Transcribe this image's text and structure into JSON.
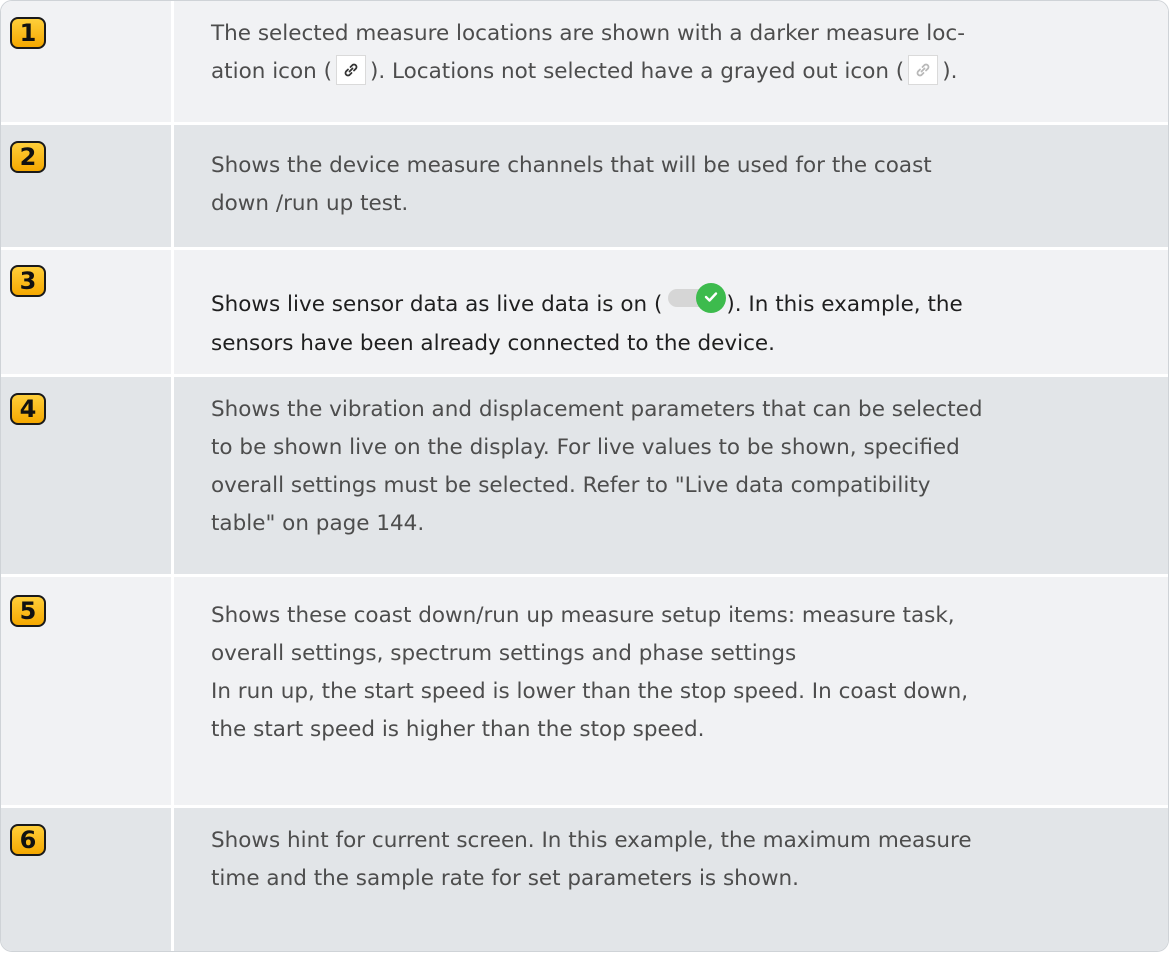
{
  "rows": [
    {
      "number": "1",
      "lines": [
        "The selected measure locations are shown with a darker measure loc-",
        "ation icon (",
        "). Locations not selected have a grayed out icon (",
        ")."
      ]
    },
    {
      "number": "2",
      "lines": [
        "Shows the device measure channels that will be used for the coast",
        "down /run up test."
      ]
    },
    {
      "number": "3",
      "lines": [
        "Shows live sensor data as live data is on (",
        "). In this example, the",
        "sensors have been already connected to the device."
      ]
    },
    {
      "number": "4",
      "lines": [
        "Shows the vibration and displacement parameters that can be selected",
        "to be shown live on the display. For live values to be shown, specified",
        "overall settings must be selected. Refer to \"Live data compatibility",
        "table\" on page 144."
      ]
    },
    {
      "number": "5",
      "lines": [
        "Shows these coast down/run up measure setup items: measure task,",
        "overall settings, spectrum settings and phase settings",
        "In run up, the start speed is lower than the stop speed. In coast down,",
        "the start speed is higher than the stop speed."
      ]
    },
    {
      "number": "6",
      "lines": [
        "Shows hint for current screen. In this example, the maximum measure",
        "time and the sample rate for set parameters is shown."
      ]
    }
  ],
  "icons": {
    "location_selected": "link-icon",
    "location_unselected": "link-icon-grayed",
    "live_data_on": "toggle-on-icon"
  },
  "colors": {
    "badge_fill": "#f5b400",
    "row_light": "#f1f2f4",
    "row_dark": "#e2e5e8",
    "text_gray": "#4d4d4d",
    "toggle_green": "#3dbb4d"
  }
}
